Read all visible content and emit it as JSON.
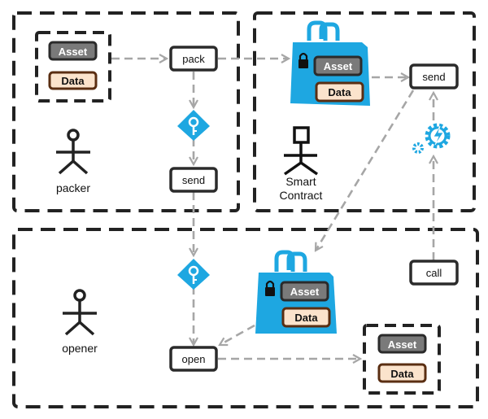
{
  "regions": {
    "packer": {
      "actor_label": "packer"
    },
    "smart_contract": {
      "actor_label_line1": "Smart",
      "actor_label_line2": "Contract"
    },
    "opener": {
      "actor_label": "opener"
    }
  },
  "nodes": {
    "pack": "pack",
    "send_packer": "send",
    "send_contract": "send",
    "call": "call",
    "open": "open"
  },
  "items": {
    "asset": "Asset",
    "data": "Data"
  },
  "colors": {
    "accent_blue": "#1ea7e1",
    "asset_fill": "#7a7a7a",
    "data_fill": "#fbe3cc",
    "data_border": "#5a2e12",
    "border_dark": "#2b2b2b",
    "arrow_gray": "#a6a6a6"
  }
}
